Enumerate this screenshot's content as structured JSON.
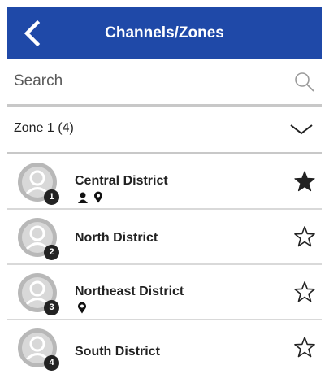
{
  "header": {
    "title": "Channels/Zones",
    "back_icon": "chevron-left-icon",
    "background": "#1f49a8"
  },
  "search": {
    "placeholder": "Search",
    "value": "",
    "icon": "search-icon"
  },
  "zone": {
    "label": "Zone 1 (4)",
    "icon": "chevron-down-icon"
  },
  "channels": [
    {
      "number": "1",
      "name": "Central District",
      "favorite": true,
      "icons": [
        "person-icon",
        "location-pin-icon"
      ]
    },
    {
      "number": "2",
      "name": "North District",
      "favorite": false,
      "icons": []
    },
    {
      "number": "3",
      "name": "Northeast District",
      "favorite": false,
      "icons": [
        "location-pin-icon"
      ]
    },
    {
      "number": "4",
      "name": "South District",
      "favorite": false,
      "icons": []
    }
  ]
}
